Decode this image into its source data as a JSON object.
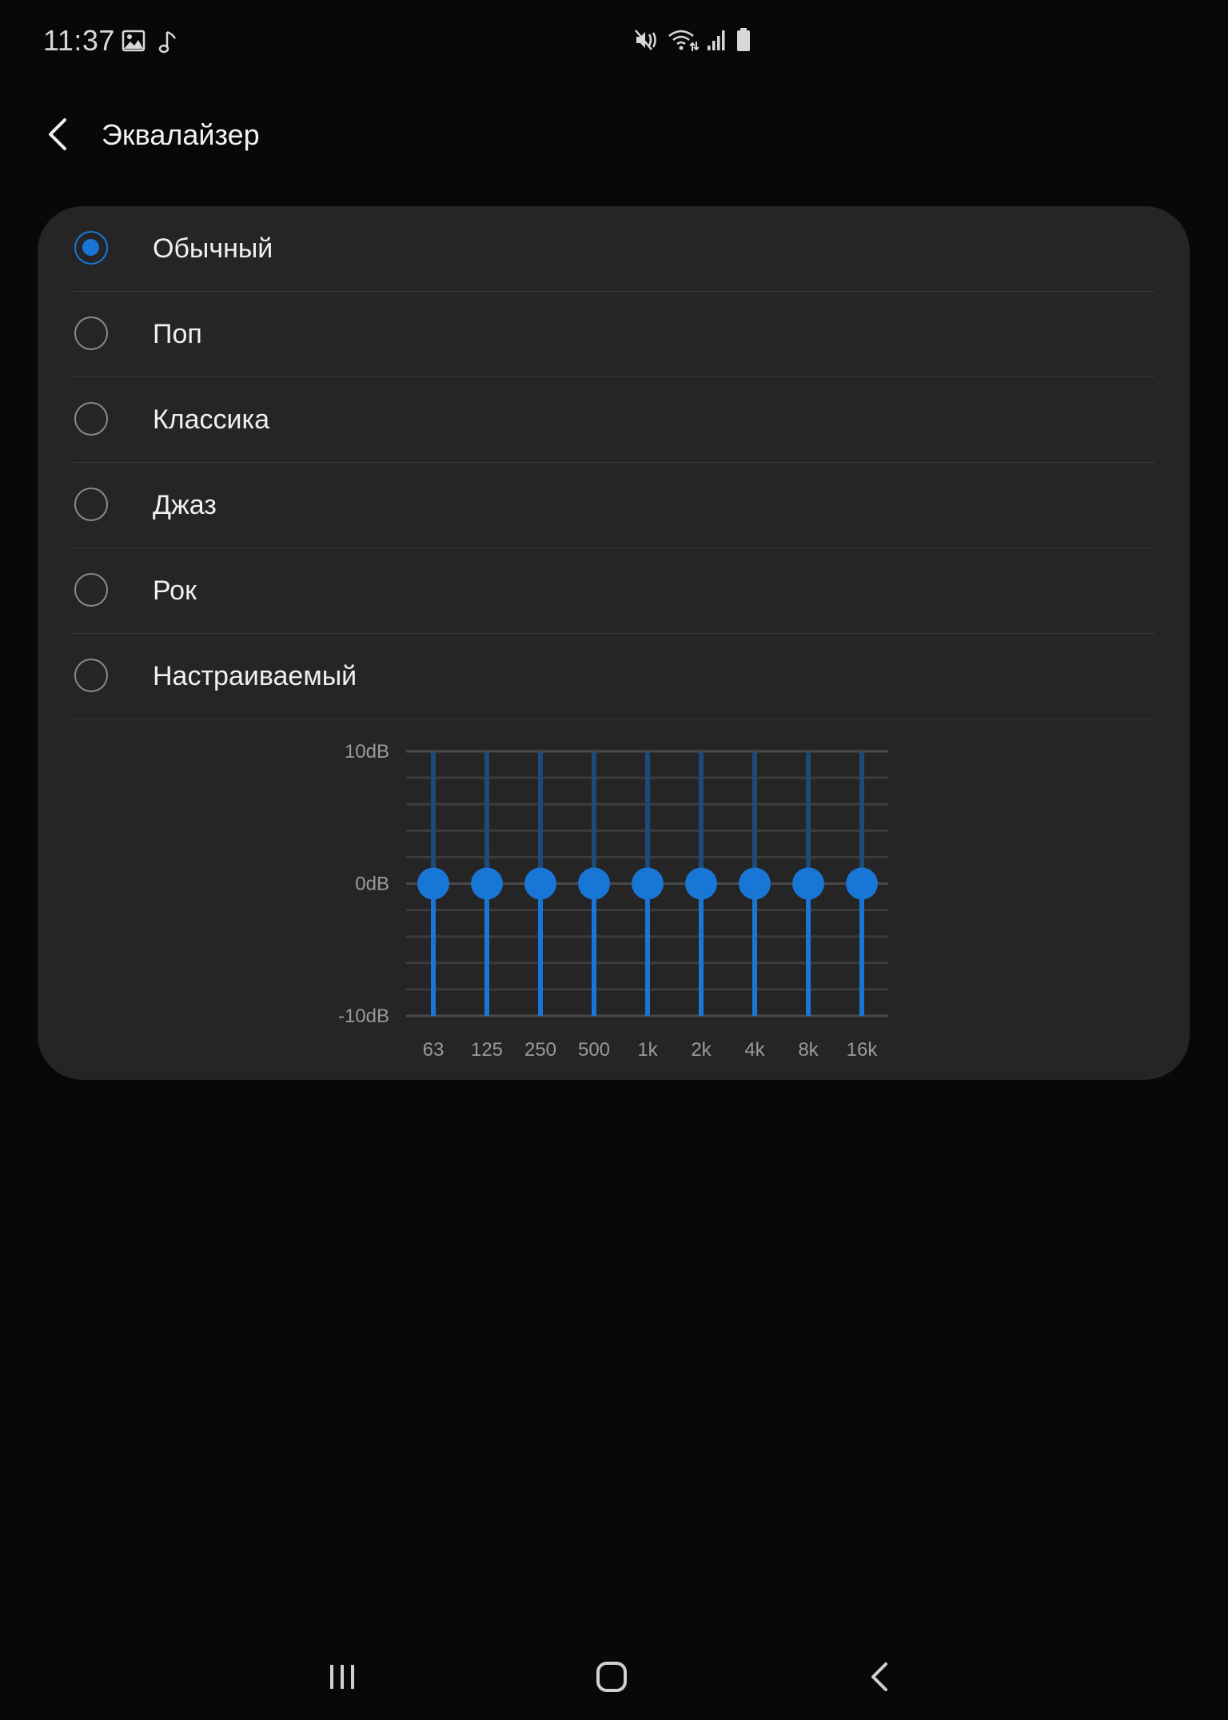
{
  "status_bar": {
    "time": "11:37",
    "left_icons": [
      "gallery-icon",
      "music-note-icon"
    ],
    "right_icons": [
      "mute-icon",
      "wifi-icon",
      "signal-icon",
      "battery-icon"
    ]
  },
  "header": {
    "title": "Эквалайзер",
    "back_icon": "chevron-left-icon"
  },
  "presets": {
    "selected": "Обычный",
    "items": [
      {
        "label": "Обычный",
        "checked": true
      },
      {
        "label": "Поп",
        "checked": false
      },
      {
        "label": "Классика",
        "checked": false
      },
      {
        "label": "Джаз",
        "checked": false
      },
      {
        "label": "Рок",
        "checked": false
      },
      {
        "label": "Настраиваемый",
        "checked": false
      }
    ]
  },
  "chart_data": {
    "type": "equalizer",
    "y_labels": [
      "10dB",
      "0dB",
      "-10dB"
    ],
    "ylim": [
      -10,
      10
    ],
    "bands": [
      "63",
      "125",
      "250",
      "500",
      "1k",
      "2k",
      "4k",
      "8k",
      "16k"
    ],
    "values": [
      0,
      0,
      0,
      0,
      0,
      0,
      0,
      0,
      0
    ],
    "grid": true,
    "accent_color": "#1877d6"
  },
  "nav_bar": {
    "buttons": [
      "recent-apps-icon",
      "home-icon",
      "back-icon"
    ]
  }
}
